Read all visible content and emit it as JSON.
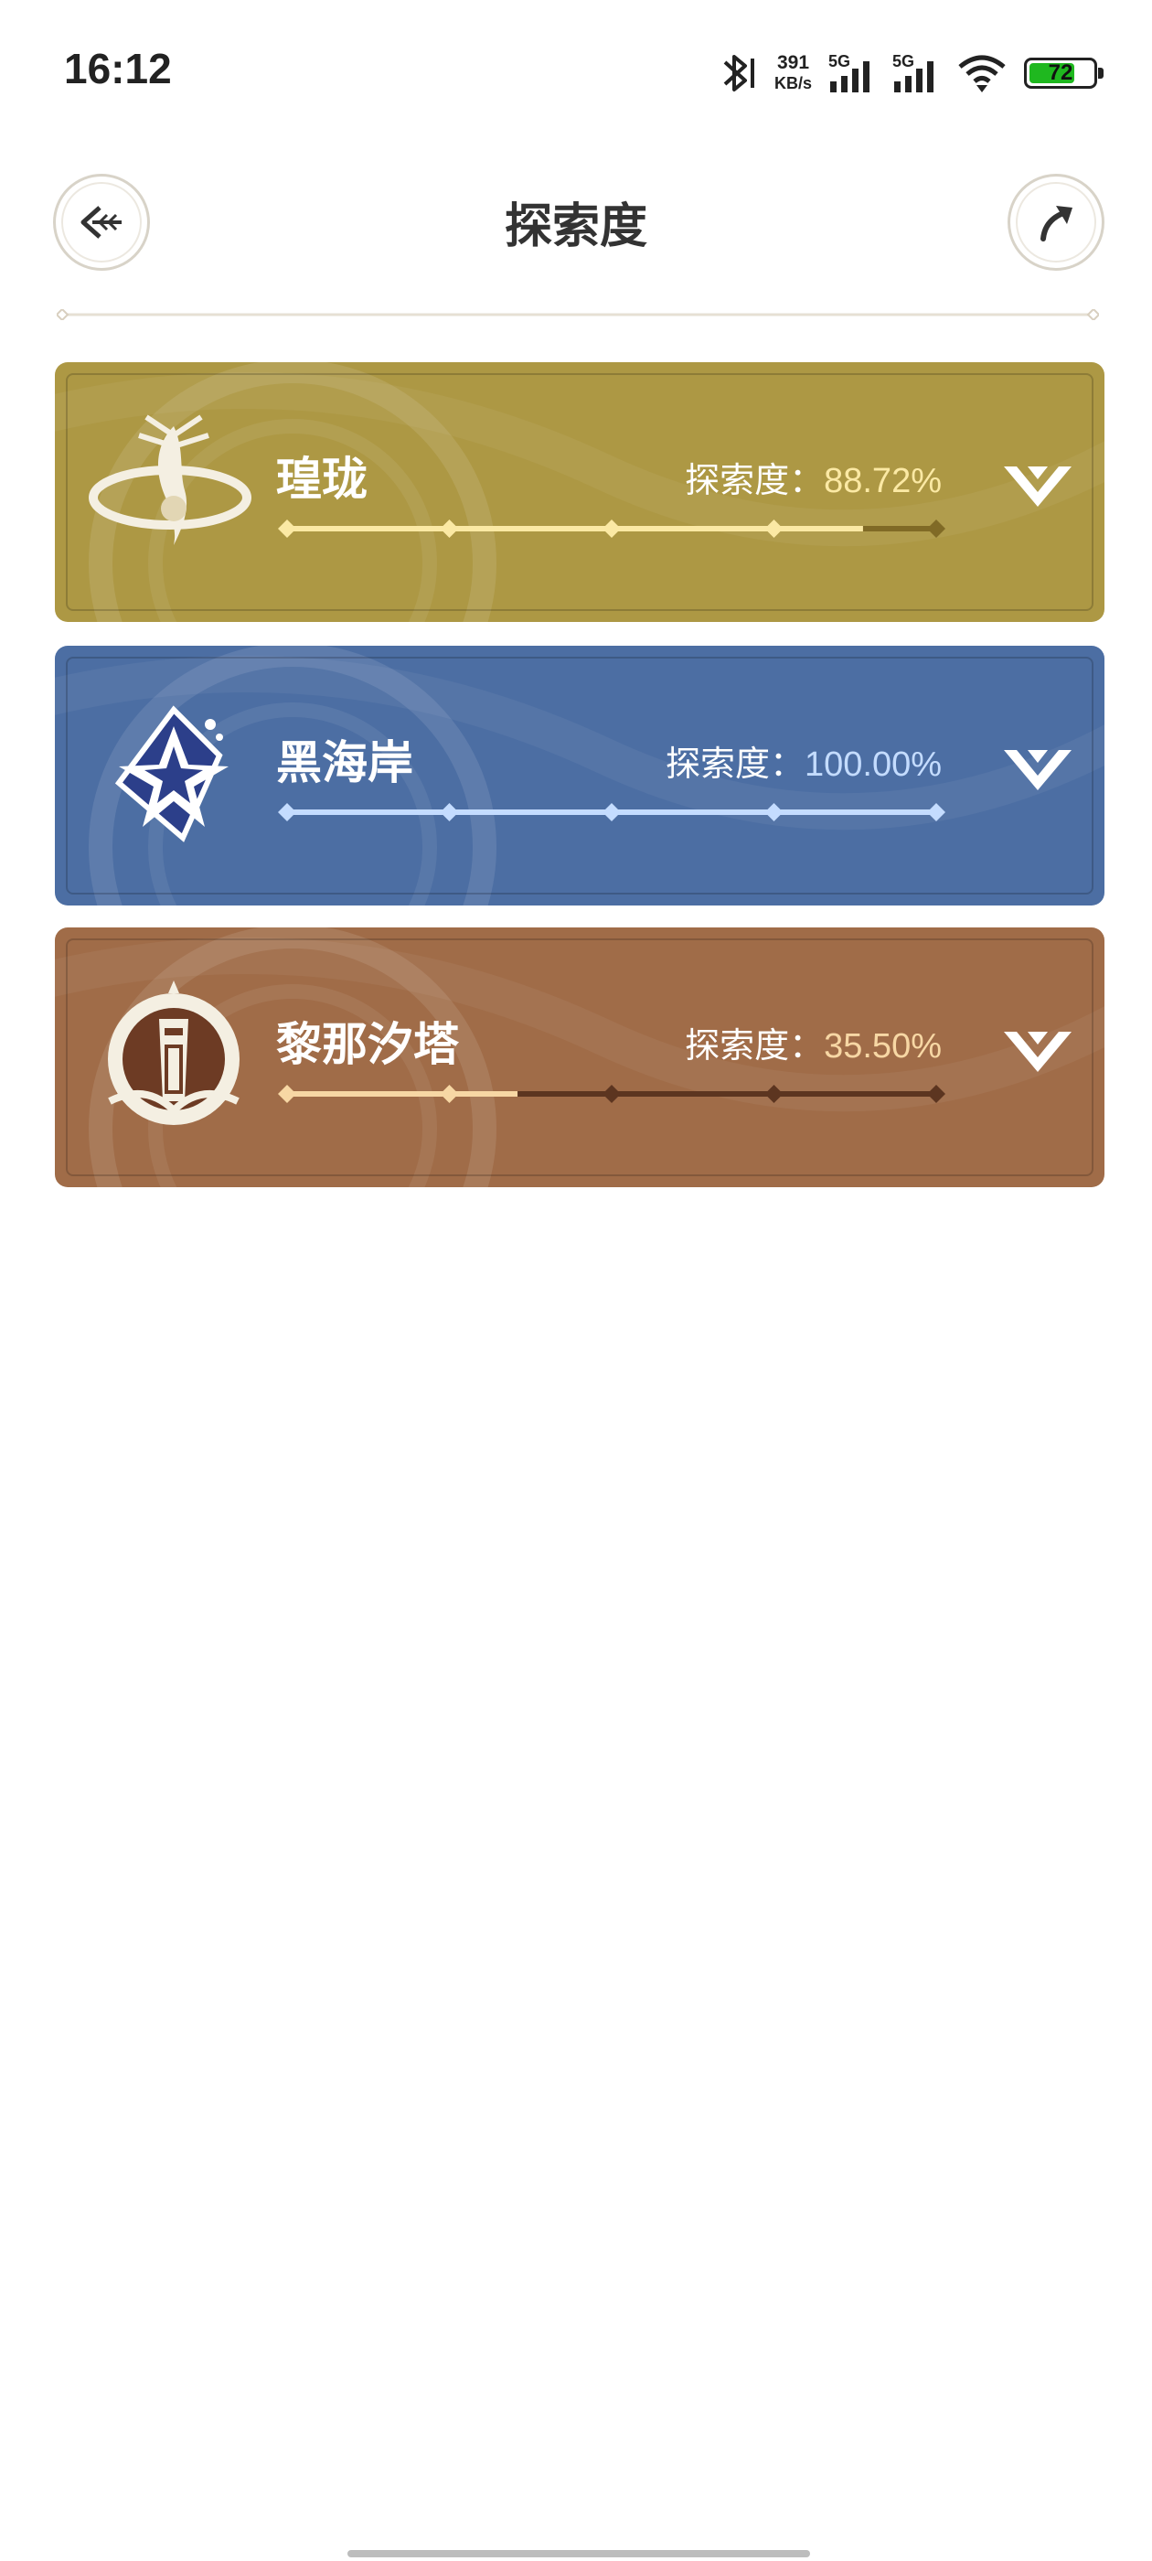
{
  "status_bar": {
    "time": "16:12",
    "net_speed_value": "391",
    "net_speed_unit": "KB/s",
    "sim1_label": "5G",
    "sim2_label": "5G",
    "battery_level": "72",
    "battery_fraction": 0.72
  },
  "header": {
    "title": "探索度",
    "back_icon": "back-arrow-icon",
    "share_icon": "share-arrow-icon"
  },
  "regions": [
    {
      "name": "瑝珑",
      "explore_label": "探索度：",
      "explore_value": "88.72%",
      "progress": 0.8872,
      "colors": {
        "bg": "#ad9844",
        "done": "#fbe9a4",
        "track": "#806a26",
        "pct": "#fbe9a4"
      }
    },
    {
      "name": "黑海岸",
      "explore_label": "探索度：",
      "explore_value": "100.00%",
      "progress": 1.0,
      "colors": {
        "bg": "#4c6ea3",
        "done": "#c4dcff",
        "track": "#2f4b78",
        "pct": "#c4dcff"
      }
    },
    {
      "name": "黎那汐塔",
      "explore_label": "探索度：",
      "explore_value": "35.50%",
      "progress": 0.355,
      "colors": {
        "bg": "#a06c48",
        "done": "#f7d7a4",
        "track": "#5c3520",
        "pct": "#f7d7a4"
      }
    }
  ]
}
